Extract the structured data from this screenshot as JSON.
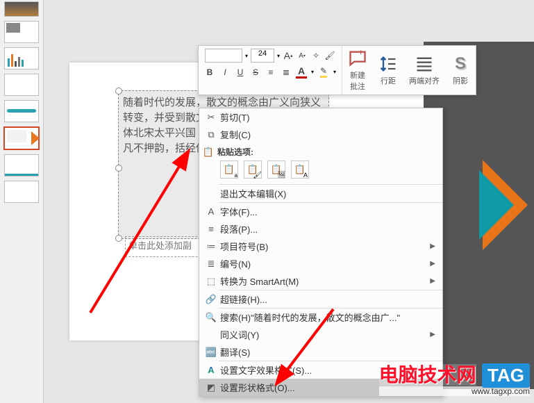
{
  "toolbar": {
    "font_size": "24",
    "increase_font": "A",
    "decrease_font": "A",
    "bold": "B",
    "italic": "I",
    "underline": "U",
    "strike": "S",
    "font_color_glyph": "A",
    "new_comment": "新建\n批注",
    "line_spacing": "行距",
    "align_both": "两端对齐",
    "shadow": "阴影",
    "shadow_glyph": "S"
  },
  "textbox_body": "随着时代的发展，散文的概念由广义向狭义转变，并受到散文是一种抒发的记叙类文学体北宋太平兴国（《辞海》认为：骈文，把凡不押韵，括经传史书），以 外 的",
  "placeholder_text": "单击此处添加副",
  "context_menu": {
    "cut": "剪切(T)",
    "copy": "复制(C)",
    "paste_title": "粘贴选项:",
    "exit_text_edit": "退出文本编辑(X)",
    "font": "字体(F)...",
    "paragraph": "段落(P)...",
    "bullets": "项目符号(B)",
    "numbering": "编号(N)",
    "convert_smartart": "转换为 SmartArt(M)",
    "hyperlink": "超链接(H)...",
    "search": "搜索(H)\"随着时代的发展，散文的概念由广...\"",
    "synonym": "同义词(Y)",
    "translate": "翻译(S)",
    "text_effects": "设置文字效果格式(S)...",
    "shape_format": "设置形状格式(O)..."
  },
  "watermark": {
    "text": "电脑技术网",
    "tag": "TAG",
    "url": "www.tagxp.com"
  }
}
